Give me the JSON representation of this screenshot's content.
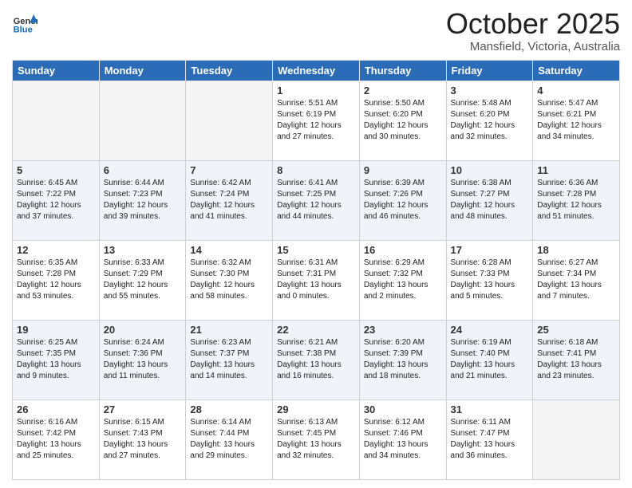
{
  "logo": {
    "general": "General",
    "blue": "Blue"
  },
  "header": {
    "month": "October 2025",
    "location": "Mansfield, Victoria, Australia"
  },
  "weekdays": [
    "Sunday",
    "Monday",
    "Tuesday",
    "Wednesday",
    "Thursday",
    "Friday",
    "Saturday"
  ],
  "weeks": [
    [
      {
        "date": "",
        "info": ""
      },
      {
        "date": "",
        "info": ""
      },
      {
        "date": "",
        "info": ""
      },
      {
        "date": "1",
        "info": "Sunrise: 5:51 AM\nSunset: 6:19 PM\nDaylight: 12 hours\nand 27 minutes."
      },
      {
        "date": "2",
        "info": "Sunrise: 5:50 AM\nSunset: 6:20 PM\nDaylight: 12 hours\nand 30 minutes."
      },
      {
        "date": "3",
        "info": "Sunrise: 5:48 AM\nSunset: 6:20 PM\nDaylight: 12 hours\nand 32 minutes."
      },
      {
        "date": "4",
        "info": "Sunrise: 5:47 AM\nSunset: 6:21 PM\nDaylight: 12 hours\nand 34 minutes."
      }
    ],
    [
      {
        "date": "5",
        "info": "Sunrise: 6:45 AM\nSunset: 7:22 PM\nDaylight: 12 hours\nand 37 minutes."
      },
      {
        "date": "6",
        "info": "Sunrise: 6:44 AM\nSunset: 7:23 PM\nDaylight: 12 hours\nand 39 minutes."
      },
      {
        "date": "7",
        "info": "Sunrise: 6:42 AM\nSunset: 7:24 PM\nDaylight: 12 hours\nand 41 minutes."
      },
      {
        "date": "8",
        "info": "Sunrise: 6:41 AM\nSunset: 7:25 PM\nDaylight: 12 hours\nand 44 minutes."
      },
      {
        "date": "9",
        "info": "Sunrise: 6:39 AM\nSunset: 7:26 PM\nDaylight: 12 hours\nand 46 minutes."
      },
      {
        "date": "10",
        "info": "Sunrise: 6:38 AM\nSunset: 7:27 PM\nDaylight: 12 hours\nand 48 minutes."
      },
      {
        "date": "11",
        "info": "Sunrise: 6:36 AM\nSunset: 7:28 PM\nDaylight: 12 hours\nand 51 minutes."
      }
    ],
    [
      {
        "date": "12",
        "info": "Sunrise: 6:35 AM\nSunset: 7:28 PM\nDaylight: 12 hours\nand 53 minutes."
      },
      {
        "date": "13",
        "info": "Sunrise: 6:33 AM\nSunset: 7:29 PM\nDaylight: 12 hours\nand 55 minutes."
      },
      {
        "date": "14",
        "info": "Sunrise: 6:32 AM\nSunset: 7:30 PM\nDaylight: 12 hours\nand 58 minutes."
      },
      {
        "date": "15",
        "info": "Sunrise: 6:31 AM\nSunset: 7:31 PM\nDaylight: 13 hours\nand 0 minutes."
      },
      {
        "date": "16",
        "info": "Sunrise: 6:29 AM\nSunset: 7:32 PM\nDaylight: 13 hours\nand 2 minutes."
      },
      {
        "date": "17",
        "info": "Sunrise: 6:28 AM\nSunset: 7:33 PM\nDaylight: 13 hours\nand 5 minutes."
      },
      {
        "date": "18",
        "info": "Sunrise: 6:27 AM\nSunset: 7:34 PM\nDaylight: 13 hours\nand 7 minutes."
      }
    ],
    [
      {
        "date": "19",
        "info": "Sunrise: 6:25 AM\nSunset: 7:35 PM\nDaylight: 13 hours\nand 9 minutes."
      },
      {
        "date": "20",
        "info": "Sunrise: 6:24 AM\nSunset: 7:36 PM\nDaylight: 13 hours\nand 11 minutes."
      },
      {
        "date": "21",
        "info": "Sunrise: 6:23 AM\nSunset: 7:37 PM\nDaylight: 13 hours\nand 14 minutes."
      },
      {
        "date": "22",
        "info": "Sunrise: 6:21 AM\nSunset: 7:38 PM\nDaylight: 13 hours\nand 16 minutes."
      },
      {
        "date": "23",
        "info": "Sunrise: 6:20 AM\nSunset: 7:39 PM\nDaylight: 13 hours\nand 18 minutes."
      },
      {
        "date": "24",
        "info": "Sunrise: 6:19 AM\nSunset: 7:40 PM\nDaylight: 13 hours\nand 21 minutes."
      },
      {
        "date": "25",
        "info": "Sunrise: 6:18 AM\nSunset: 7:41 PM\nDaylight: 13 hours\nand 23 minutes."
      }
    ],
    [
      {
        "date": "26",
        "info": "Sunrise: 6:16 AM\nSunset: 7:42 PM\nDaylight: 13 hours\nand 25 minutes."
      },
      {
        "date": "27",
        "info": "Sunrise: 6:15 AM\nSunset: 7:43 PM\nDaylight: 13 hours\nand 27 minutes."
      },
      {
        "date": "28",
        "info": "Sunrise: 6:14 AM\nSunset: 7:44 PM\nDaylight: 13 hours\nand 29 minutes."
      },
      {
        "date": "29",
        "info": "Sunrise: 6:13 AM\nSunset: 7:45 PM\nDaylight: 13 hours\nand 32 minutes."
      },
      {
        "date": "30",
        "info": "Sunrise: 6:12 AM\nSunset: 7:46 PM\nDaylight: 13 hours\nand 34 minutes."
      },
      {
        "date": "31",
        "info": "Sunrise: 6:11 AM\nSunset: 7:47 PM\nDaylight: 13 hours\nand 36 minutes."
      },
      {
        "date": "",
        "info": ""
      }
    ]
  ]
}
